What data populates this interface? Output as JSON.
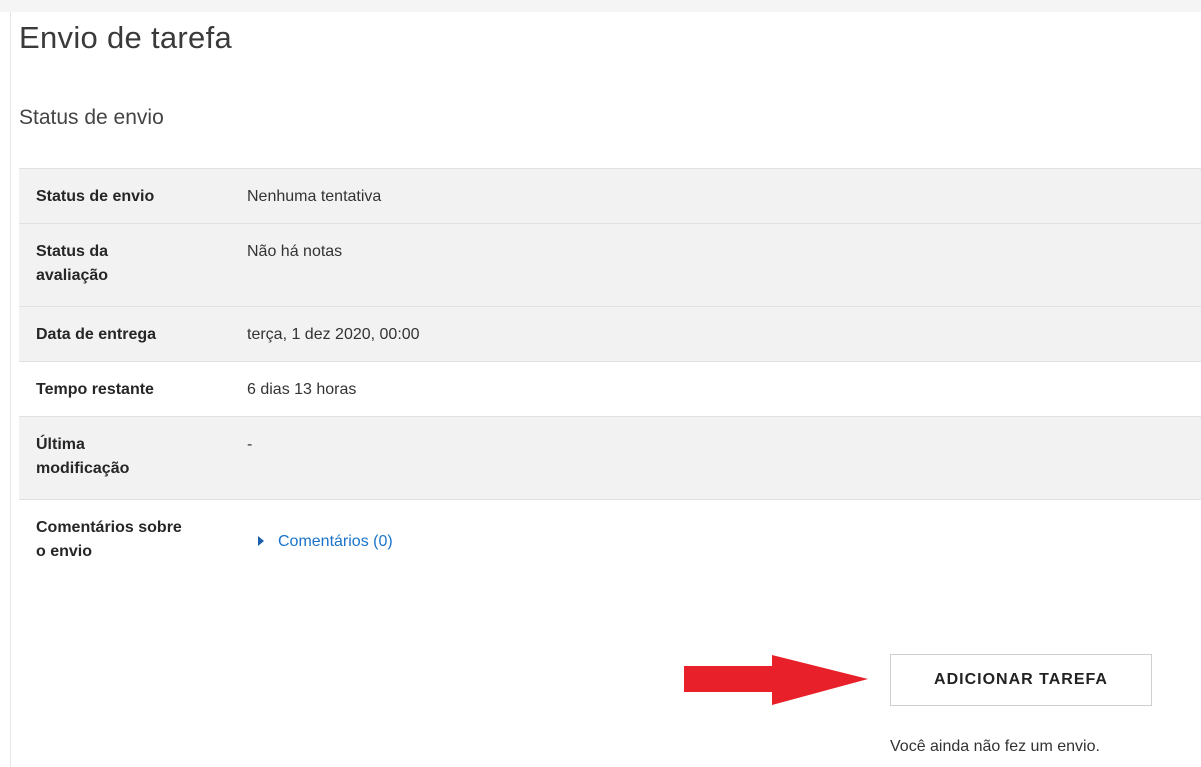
{
  "page": {
    "title": "Envio de tarefa",
    "section_title": "Status de envio"
  },
  "status_rows": [
    {
      "label": "Status de envio",
      "value": "Nenhuma tentativa"
    },
    {
      "label": "Status da avaliação",
      "value": "Não há notas"
    },
    {
      "label": "Data de entrega",
      "value": "terça, 1 dez 2020, 00:00"
    },
    {
      "label": "Tempo restante",
      "value": "6 dias 13 horas"
    },
    {
      "label": "Última modificação",
      "value": "-"
    },
    {
      "label": "Comentários sobre o envio",
      "value": "Comentários (0)"
    }
  ],
  "actions": {
    "add_button_label": "ADICIONAR TAREFA",
    "note": "Você ainda não fez um envio."
  },
  "annotation": {
    "arrow_color": "#e8202a",
    "arrow_icon": "arrow-right-icon"
  },
  "colors": {
    "link": "#1a73c9",
    "row_shaded": "#f2f2f2"
  }
}
